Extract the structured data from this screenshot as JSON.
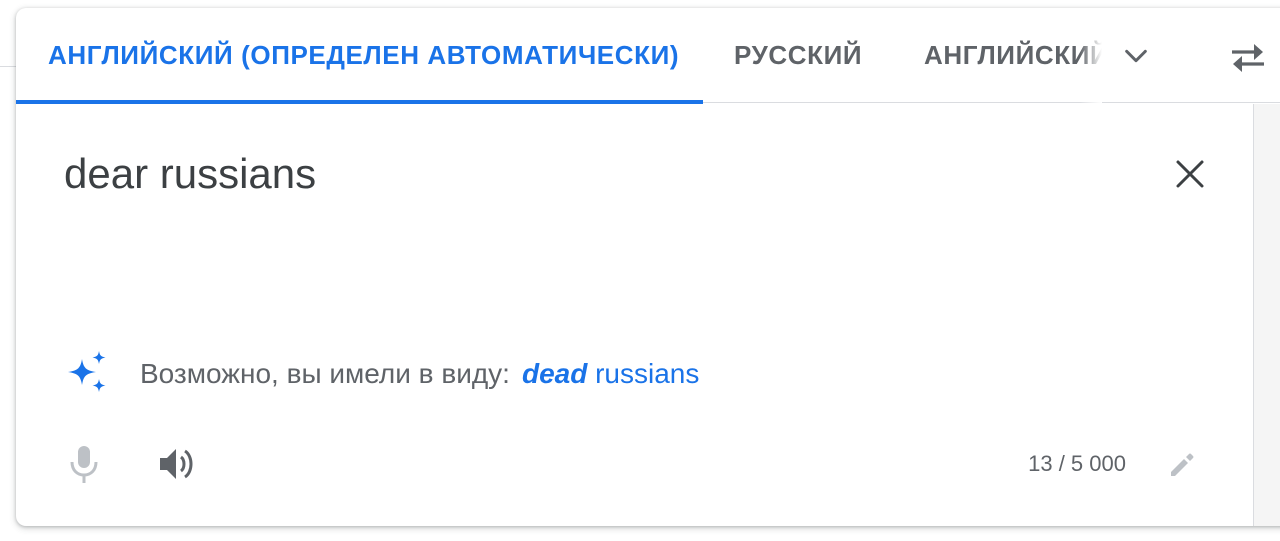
{
  "lang_bar": {
    "source_detected": "АНГЛИЙСКИЙ (ОПРЕДЕЛЕН АВТОМАТИЧЕСКИ)",
    "lang_russian": "РУССКИЙ",
    "lang_english": "АНГЛИЙСКИЙ",
    "more_icon": "chevron-down-icon",
    "swap_icon": "swap-arrows-icon"
  },
  "source": {
    "text": "dear russians",
    "clear_icon": "close-icon"
  },
  "suggestion": {
    "icon": "sparkle-icon",
    "label": "Возможно, вы имели в виду:",
    "corrected_word": "dead",
    "rest": "russians"
  },
  "footer": {
    "mic_icon": "microphone-icon",
    "speaker_icon": "speaker-icon",
    "char_count": "13 / 5 000",
    "edit_icon": "pencil-icon"
  },
  "colors": {
    "accent": "#1a73e8",
    "text_primary": "#3c4043",
    "text_secondary": "#5f6368",
    "divider": "#dadce0"
  }
}
